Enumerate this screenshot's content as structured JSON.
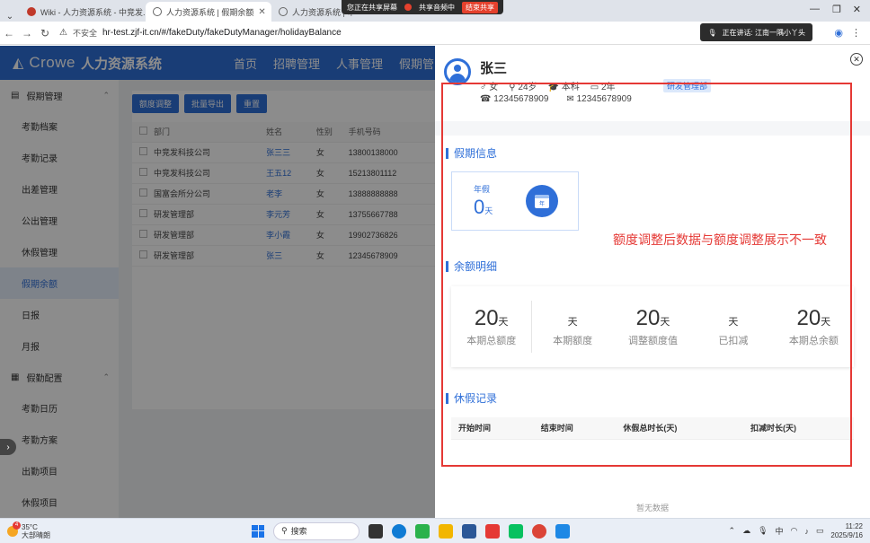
{
  "browser": {
    "tabs": [
      {
        "title": "Wiki - 人力资源系统 - 中竞发...",
        "active": false
      },
      {
        "title": "人力资源系统 | 假期余额",
        "active": true
      },
      {
        "title": "人力资源系统 | 审...",
        "active": false
      }
    ],
    "share_bar": {
      "status": "您正在共享屏幕",
      "audio": "共享音频中",
      "stop": "结束共享"
    },
    "insecure_label": "不安全",
    "url": "hr-test.zjf-it.cn/#/fakeDuty/fakeDutyManager/holidayBalance",
    "speaking": "正在讲话: 江南一隅小丫头"
  },
  "app": {
    "logo_brand": "Crowe",
    "logo_title": "人力资源系统",
    "top_menu": [
      "首页",
      "招聘管理",
      "人事管理",
      "假期管"
    ],
    "sidebar": {
      "group1": "假期管理",
      "group1_items": [
        "考勤档案",
        "考勤记录",
        "出差管理",
        "公出管理",
        "休假管理",
        "假期余额",
        "日报",
        "月报"
      ],
      "active_item": "假期余额",
      "group2": "假勤配置",
      "group2_items": [
        "考勤日历",
        "考勤方案",
        "出勤项目",
        "休假项目"
      ]
    },
    "buttons": [
      "额度调整",
      "批量导出",
      "重置"
    ],
    "table": {
      "headers": [
        "部门",
        "姓名",
        "性别",
        "手机号码"
      ],
      "rows": [
        [
          "中竞发科技公司",
          "张三三",
          "女",
          "13800138000"
        ],
        [
          "中竞发科技公司",
          "王五12",
          "女",
          "15213801112"
        ],
        [
          "国富会所分公司",
          "老李",
          "女",
          "13888888888"
        ],
        [
          "研发管理部",
          "李元芳",
          "女",
          "13755667788"
        ],
        [
          "研发管理部",
          "李小霞",
          "女",
          "19902736826"
        ],
        [
          "研发管理部",
          "张三",
          "女",
          "12345678909"
        ]
      ]
    }
  },
  "drawer": {
    "close_icon": "close-icon",
    "employee": {
      "name": "张三",
      "gender": "女",
      "age": "24岁",
      "education": "本科",
      "tenure": "2年",
      "department": "研发管理部",
      "phone": "12345678909",
      "email": "12345678909"
    },
    "section_leave_info": "假期信息",
    "leave_card": {
      "type": "年假",
      "days": "0",
      "unit": "天",
      "icon_text": "年"
    },
    "annotation": "额度调整后数据与额度调整展示不一致",
    "section_balance": "余额明细",
    "balance": [
      {
        "num": "20",
        "unit": "天",
        "label": "本期总额度"
      },
      {
        "num": "",
        "unit": "天",
        "label": "本期额度"
      },
      {
        "num": "20",
        "unit": "天",
        "label": "调整额度值"
      },
      {
        "num": "",
        "unit": "天",
        "label": "已扣减"
      },
      {
        "num": "20",
        "unit": "天",
        "label": "本期总余额"
      }
    ],
    "section_records": "休假记录",
    "record_headers": [
      "开始时间",
      "结束时间",
      "休假总时长(天)",
      "扣减时长(天)"
    ],
    "empty_text": "暂无数据",
    "annotation_color": "#e53935"
  },
  "taskbar": {
    "weather_temp": "35°C",
    "weather_desc": "大部晴朗",
    "weather_badge": "4",
    "search": "搜索",
    "ime": "中",
    "time": "11:22",
    "date": "2025/9/16"
  },
  "colors": {
    "primary": "#2f6fd8",
    "danger": "#e53935"
  }
}
